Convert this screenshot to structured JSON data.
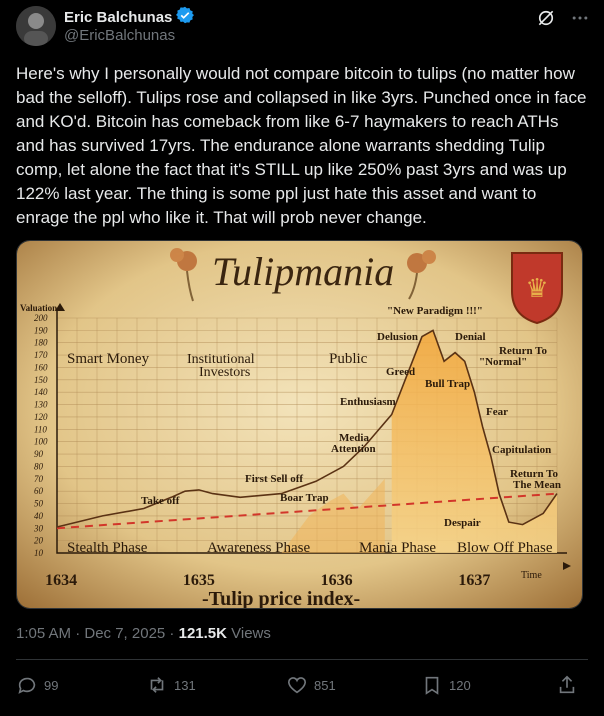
{
  "author": {
    "name": "Eric Balchunas",
    "handle": "@EricBalchunas"
  },
  "tweet": {
    "text": "Here's why I personally would not compare bitcoin to tulips (no matter how bad the selloff). Tulips rose and collapsed in like 3yrs. Punched once in face and KO'd. Bitcoin has comeback from like 6-7 haymakers to reach ATHs and has survived 17yrs. The endurance alone warrants shedding Tulip comp, let alone the fact that it's STILL up like 250% past 3yrs and was up 122% last year. The thing is some ppl just hate this asset and want to enrage the ppl who like it. That will prob never change."
  },
  "meta": {
    "time": "1:05 AM · Dec 7, 2025",
    "separator": " · ",
    "views_count": "121.5K",
    "views_label": " Views"
  },
  "actions": {
    "replies": "99",
    "reposts": "131",
    "likes": "851",
    "bookmarks": "120"
  },
  "chart_data": {
    "type": "line",
    "title": "Tulipmania",
    "subtitle": "-Tulip price index-",
    "ylabel": "Valuation",
    "xlabel": "Time",
    "ylim": [
      10,
      200
    ],
    "yticks": [
      10,
      20,
      30,
      40,
      50,
      60,
      70,
      80,
      90,
      100,
      110,
      120,
      130,
      140,
      150,
      160,
      170,
      180,
      190,
      200
    ],
    "x_ticks": [
      "1634",
      "1635",
      "1636",
      "1637"
    ],
    "phases": [
      "Stealth Phase",
      "Awareness Phase",
      "Mania Phase",
      "Blow Off Phase"
    ],
    "crowd_labels": [
      "Smart Money",
      "Institutional Investors",
      "Public"
    ],
    "annotations": [
      "Take off",
      "First Sell off",
      "Boar Trap",
      "Media Attention",
      "Enthusiasm",
      "Greed",
      "Delusion",
      "\"New Paradigm !!!\"",
      "Denial",
      "Bull Trap",
      "Return To \"Normal\"",
      "Fear",
      "Capitulation",
      "Return To The Mean",
      "Despair"
    ],
    "series": [
      {
        "name": "",
        "x": [
          1633.97,
          1634.3,
          1634.6,
          1634.8,
          1634.9,
          1635.0,
          1635.1,
          1635.3,
          1635.6,
          1635.85,
          1636.05,
          1636.2,
          1636.4,
          1636.55,
          1636.62,
          1636.7,
          1636.78,
          1636.86,
          1636.93,
          1637.0,
          1637.06,
          1637.12,
          1637.18,
          1637.25,
          1637.35,
          1637.5,
          1637.6
        ],
        "values": [
          31,
          40,
          46,
          55,
          60,
          61,
          58,
          55,
          58,
          68,
          80,
          96,
          122,
          165,
          185,
          190,
          165,
          172,
          165,
          140,
          112,
          88,
          58,
          35,
          33,
          42,
          58
        ]
      }
    ]
  }
}
